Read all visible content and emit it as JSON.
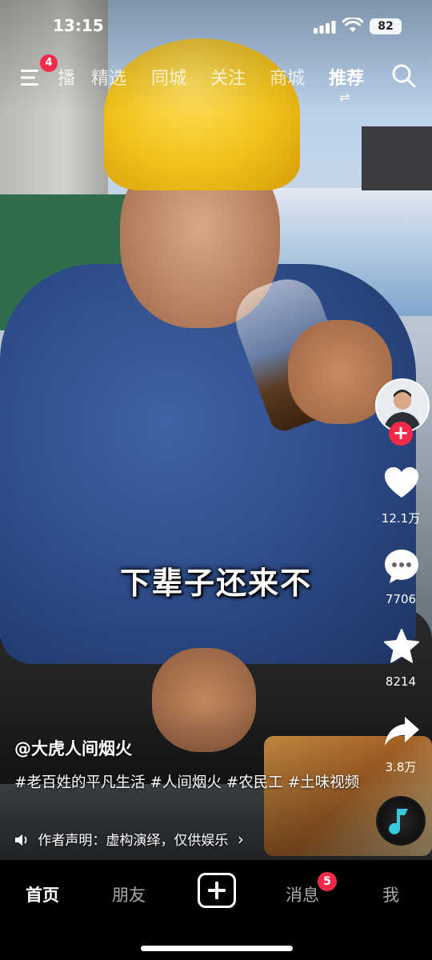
{
  "status_bar": {
    "time": "13:15",
    "battery": "82"
  },
  "top_nav": {
    "menu_badge": "4",
    "tabs": [
      {
        "label": "播",
        "active": false
      },
      {
        "label": "精选",
        "active": false
      },
      {
        "label": "同城",
        "active": false
      },
      {
        "label": "关注",
        "active": false
      },
      {
        "label": "商城",
        "active": false
      },
      {
        "label": "推荐",
        "active": true
      }
    ],
    "active_switch_glyph": "⇌"
  },
  "video": {
    "subtitle": "下辈子还来不",
    "author": "@大虎人间烟火",
    "description": "#老百姓的平凡生活 #人间烟火 #农民工 #土味视频",
    "declaration": "作者声明：虚构演绎，仅供娱乐",
    "declaration_chevron": "›"
  },
  "right_rail": {
    "follow_label": "+",
    "likes": "12.1万",
    "comments": "7706",
    "favorites": "8214",
    "shares": "3.8万"
  },
  "bottom_tabs": {
    "home": "首页",
    "friends": "朋友",
    "create": "+",
    "messages": "消息",
    "messages_badge": "5",
    "me": "我"
  },
  "colors": {
    "accent": "#f5294a",
    "helmet": "#f2c21a",
    "shirt": "#2c4a86"
  }
}
